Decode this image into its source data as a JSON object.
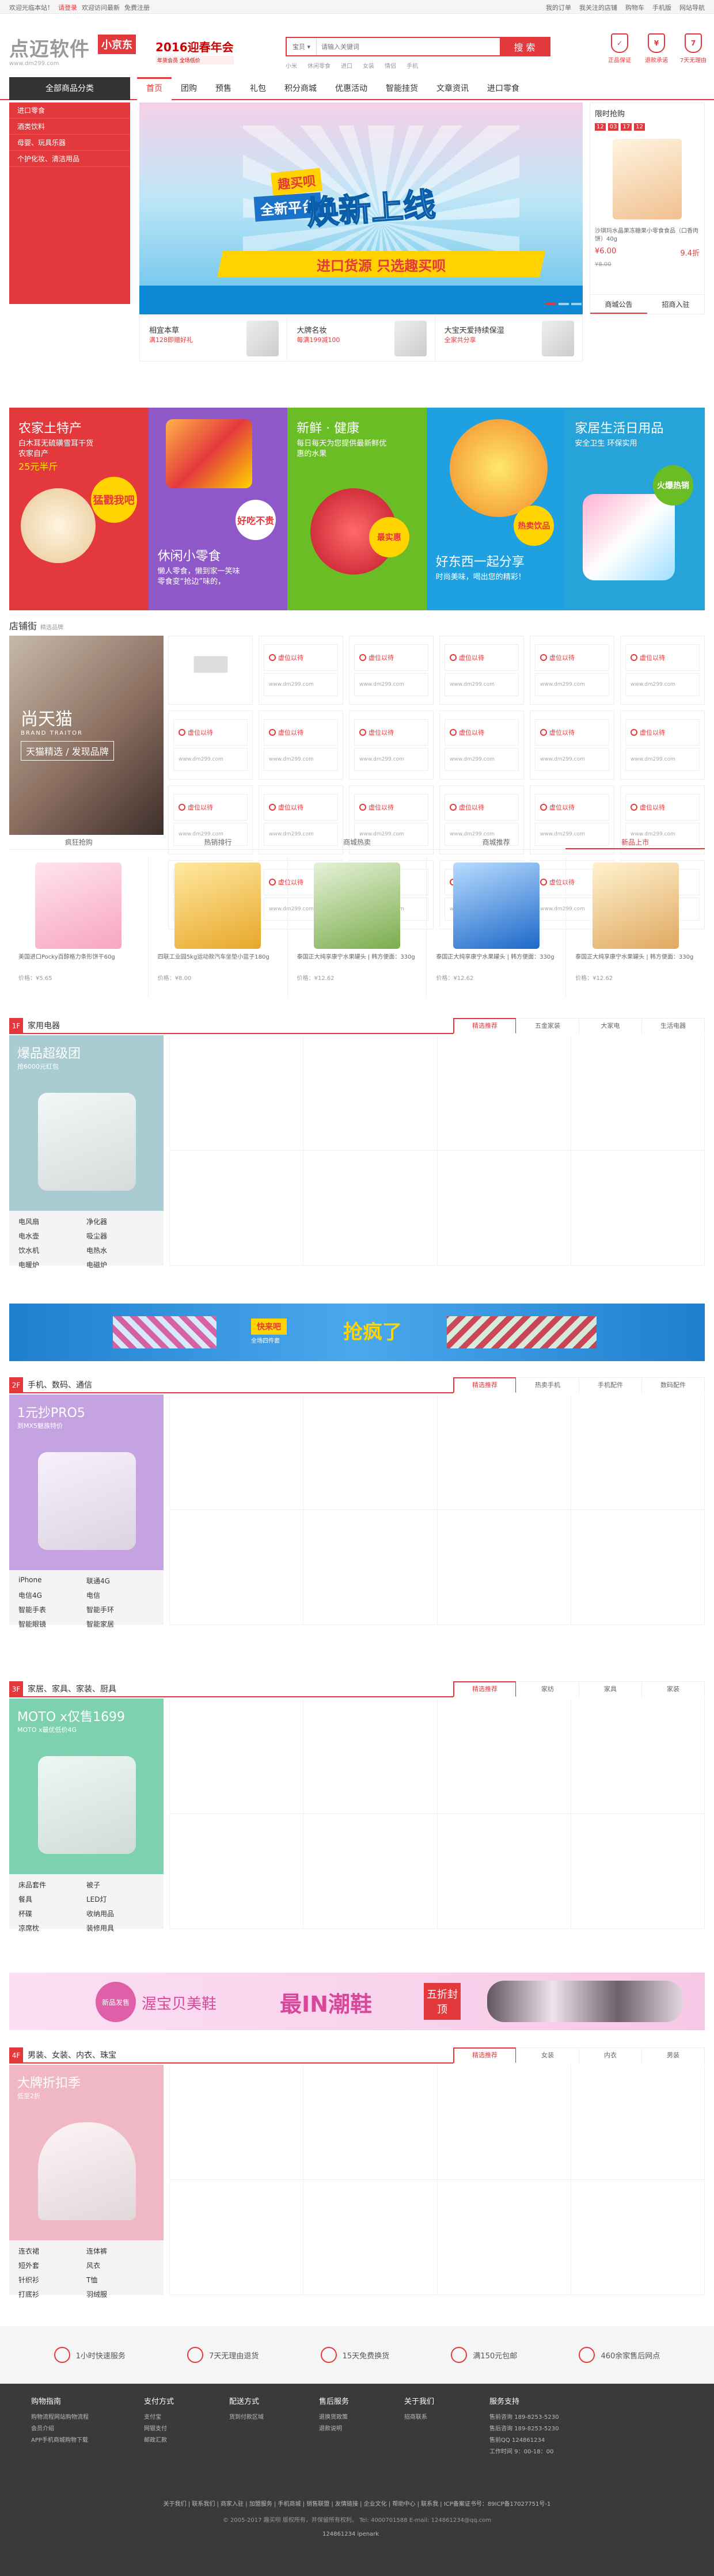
{
  "topbar": {
    "left": [
      "欢迎光临本站！",
      "请登录",
      "欢迎访问最新",
      "免费注册"
    ],
    "right": [
      "我的订单",
      "我关注的店铺",
      "购物车",
      "手机版",
      "网站导航"
    ]
  },
  "header": {
    "logo": "点迈软件",
    "logo_sub": "www.dm299.com",
    "badge": "小京东",
    "promo": "2016迎春年会",
    "promo_sub": "年货会员 全场低价",
    "search_scope": "宝贝",
    "search_placeholder": "请输入关键词",
    "search_button": "搜 索",
    "hotwords": [
      "小米",
      "休闲零食",
      "进口",
      "女装",
      "情侣",
      "手机"
    ],
    "services": [
      "正品保证",
      "退款承诺",
      "7天无理由"
    ]
  },
  "nav": {
    "all_categories": "全部商品分类",
    "items": [
      "首页",
      "团购",
      "预售",
      "礼包",
      "积分商城",
      "优惠活动",
      "智能挂货",
      "文章资讯",
      "进口零食"
    ]
  },
  "categories": [
    "进口零食",
    "酒类饮料",
    "母婴、玩具乐器",
    "个护化妆、清洁用品"
  ],
  "banner": {
    "badge": "趣买呗",
    "sub": "全新平台",
    "main": "焕新上线",
    "strip": "进口货源  只选趣买呗"
  },
  "subads": [
    {
      "title": "相宜本草",
      "desc": "满128即赠好礼"
    },
    {
      "title": "大牌名妆",
      "desc": "每满199减100"
    },
    {
      "title": "大宝天爱持续保湿",
      "desc": "全家共分享"
    }
  ],
  "flash": {
    "title": "限时抢购",
    "countdown": [
      "12",
      "03",
      "17",
      "12"
    ],
    "product": "沙琪玛水晶果冻糖果小零食食品（口香肉饼）40g",
    "price": "¥6.00",
    "orig_price": "¥8.00",
    "discount": "9.4折",
    "tabs": [
      "商城公告",
      "招商入驻"
    ]
  },
  "promo_cards": [
    {
      "title": "农家土特产",
      "desc": "白木耳无硫磺雪耳干货\n农家自产",
      "highlight": "25元半斤",
      "tag": "猛戳我吧",
      "color": "#e4393c"
    },
    {
      "title": "休闲小零食",
      "desc": "懒人零食，懒到家一笑味\n零食变“抢边”味的，",
      "tag": "好吃不贵",
      "color": "#8e58c9"
    },
    {
      "title": "新鲜 · 健康",
      "desc": "每日每天为您提供最新鲜优\n惠的水果",
      "tag": "最实惠",
      "color": "#6bbd25"
    },
    {
      "title": "好东西一起分享",
      "desc": "时尚美味，喝出您的精彩！",
      "tag": "热卖饮品",
      "color": "#1fa0e0"
    },
    {
      "title": "家居生活日用品",
      "desc": "安全卫生 环保实用",
      "tag": "火爆热销",
      "color": "#26a4d9"
    }
  ],
  "store": {
    "heading": "店铺街",
    "heading_sub": "精选品牌",
    "feature_name": "尚天猫",
    "feature_en": "BRAND TRAITOR",
    "feature_tagline": "天猫精选 / 发现品牌",
    "cell_label": "虚位以待",
    "cell_url": "www.dm299.com"
  },
  "rank_tabs": [
    "疯狂抢购",
    "热销排行",
    "商城热卖",
    "商城推荐",
    "新品上市"
  ],
  "goods": [
    {
      "name": "美国进口Pocky百醇格力条形饼干60g",
      "price": "价格：¥5.65"
    },
    {
      "name": "四联工业园5kg运动款汽车坐垫小蓝子180g",
      "price": "价格：¥8.00"
    },
    {
      "name": "泰国正大纯享康宁水果罐头 | 韩方便面：330g",
      "price": "价格：¥12.62"
    },
    {
      "name": "泰国正大纯享康宁水果罐头 | 韩方便面：330g",
      "price": "价格：¥12.62"
    },
    {
      "name": "泰国正大纯享康宁水果罐头 | 韩方便面：330g",
      "price": "价格：¥12.62"
    }
  ],
  "floors": [
    {
      "num": "1F",
      "title": "家用电器",
      "tabs": [
        "精选推荐",
        "五金家装",
        "大家电",
        "生活电器"
      ],
      "hero_title": "爆品超级团",
      "hero_sub": "抢6000元红包",
      "hero_color": "#a9cbd2",
      "links": [
        "电风扇",
        "净化器",
        "电水壶",
        "吸尘器",
        "饮水机",
        "电热水",
        "电暖炉",
        "电磁炉"
      ]
    },
    {
      "num": "2F",
      "title": "手机、数码、通信",
      "tabs": [
        "精选推荐",
        "热卖手机",
        "手机配件",
        "数码配件"
      ],
      "hero_title": "1元抄PRO5",
      "hero_sub": "到MX5魅族特价",
      "hero_color": "#c5a2e0",
      "links": [
        "iPhone",
        "联通4G",
        "电信4G",
        "电信",
        "智能手表",
        "智能手环",
        "智能眼镜",
        "智能家居"
      ]
    },
    {
      "num": "3F",
      "title": "家居、家具、家装、厨具",
      "tabs": [
        "精选推荐",
        "家纺",
        "家具",
        "家装"
      ],
      "hero_title": "MOTO x仅售1699",
      "hero_sub": "MOTO x最优低价4G",
      "hero_color": "#7ed1b0",
      "links": [
        "床品套件",
        "被子",
        "餐具",
        "LED灯",
        "杯碟",
        "收纳用品",
        "凉席枕",
        "装修用具"
      ]
    },
    {
      "num": "4F",
      "title": "男装、女装、内衣、珠宝",
      "tabs": [
        "精选推荐",
        "女装",
        "内衣",
        "男装"
      ],
      "hero_title": "大牌折扣季",
      "hero_sub": "低至2折",
      "hero_color": "#f0b8c4",
      "links": [
        "连衣裙",
        "连体裤",
        "短外套",
        "风衣",
        "针织衫",
        "T恤",
        "打底衫",
        "羽绒服"
      ]
    }
  ],
  "ad1": {
    "text1": "快来吧",
    "text2": "抢疯了",
    "sub": "全场四件套"
  },
  "ad2": {
    "brand": "渥宝贝美鞋",
    "text": "最IN潮鞋",
    "sub": "五折封顶",
    "badge": "新品发售"
  },
  "benefits": [
    "1小时快速服务",
    "7天无理由退货",
    "15天免费换货",
    "满150元包邮",
    "460余家售后网点"
  ],
  "footer": {
    "cols": [
      {
        "title": "购物指南",
        "items": [
          "购物流程网站购物流程",
          "会员介绍",
          "APP手机商城购物下载"
        ]
      },
      {
        "title": "支付方式",
        "items": [
          "支付宝",
          "网银支付",
          "邮政汇款"
        ]
      },
      {
        "title": "配送方式",
        "items": [
          "货到付款区域"
        ]
      },
      {
        "title": "售后服务",
        "items": [
          "退换货政策",
          "退款说明"
        ]
      },
      {
        "title": "关于我们",
        "items": [
          "招商联系"
        ]
      },
      {
        "title": "服务支持",
        "items": [
          "售前咨询 189-8253-5230",
          "售后咨询 189-8253-5230",
          "售前QQ 124861234",
          "工作时间 9：00-18：00"
        ]
      }
    ],
    "links": "关于我们 | 联系我们 | 商家入驻 | 加盟服务 | 手机商城 | 销售联盟 | 友情链接 | 企业文化 | 帮助中心 | 联系我 | ICP备案证书号：89ICP备17027751号-1",
    "copyright": "© 2005-2017 趣买呗 版权所有，并保留所有权利。",
    "tel": "Tel: 4000701588 E-mail: 124861234@qq.com",
    "bottom": "124861234     ipenark"
  }
}
